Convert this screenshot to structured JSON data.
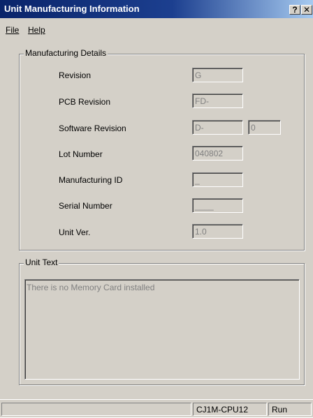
{
  "window": {
    "title": "Unit Manufacturing Information",
    "help_button": "?",
    "close_button": "✕"
  },
  "menu": {
    "file": "File",
    "help": "Help"
  },
  "manufacturing": {
    "group_title": "Manufacturing Details",
    "rows": [
      {
        "label": "Revision",
        "value": "G"
      },
      {
        "label": "PCB Revision",
        "value": "FD-"
      },
      {
        "label": "Software Revision",
        "value": "D-",
        "value2": "0"
      },
      {
        "label": "Lot Number",
        "value": "040802"
      },
      {
        "label": "Manufacturing ID",
        "value": "_"
      },
      {
        "label": "Serial Number",
        "value": "____"
      },
      {
        "label": "Unit Ver.",
        "value": "1.0"
      }
    ]
  },
  "unit_text": {
    "group_title": "Unit Text",
    "content": "There is no Memory Card installed"
  },
  "status": {
    "model": "CJ1M-CPU12",
    "mode": "Run"
  }
}
